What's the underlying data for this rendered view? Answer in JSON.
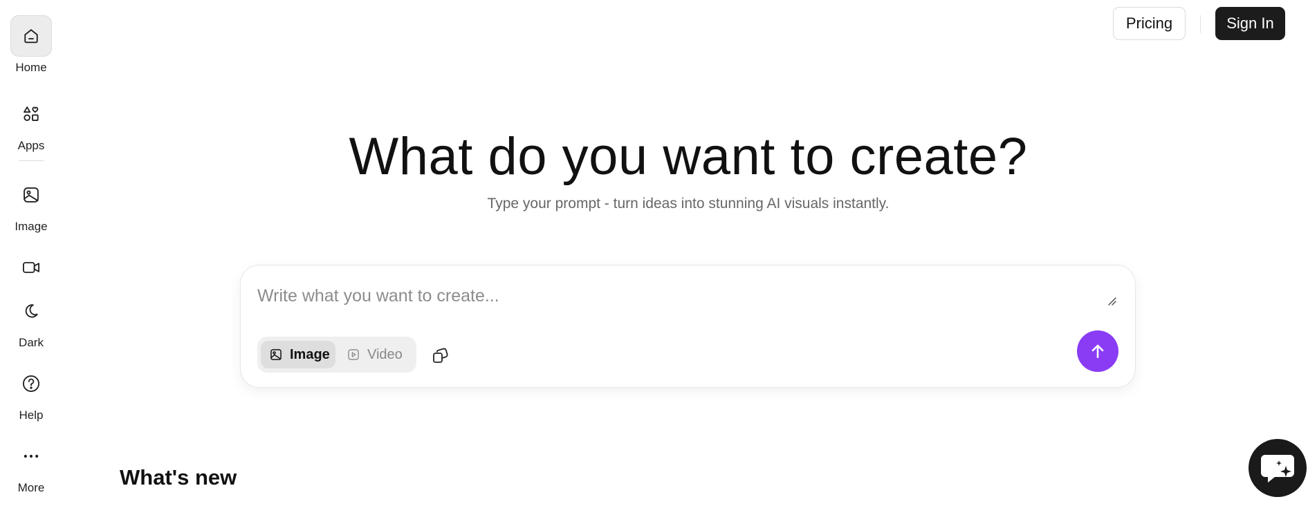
{
  "sidebar": {
    "items": [
      {
        "label": "Home",
        "icon": "home-icon"
      },
      {
        "label": "Apps",
        "icon": "apps-icon"
      },
      {
        "label": "Image",
        "icon": "image-icon"
      },
      {
        "label": "",
        "icon": "video-camera-icon"
      },
      {
        "label": "Dark",
        "icon": "moon-icon"
      },
      {
        "label": "Help",
        "icon": "help-circle-icon"
      },
      {
        "label": "More",
        "icon": "more-dots-icon"
      }
    ]
  },
  "header": {
    "pricing_label": "Pricing",
    "signin_label": "Sign In"
  },
  "hero": {
    "title": "What do you want to create?",
    "subtitle": "Type your prompt - turn ideas into stunning AI visuals instantly."
  },
  "prompt": {
    "placeholder": "Write what you want to create...",
    "value": "",
    "modes": [
      {
        "label": "Image",
        "selected": true,
        "icon": "image-icon"
      },
      {
        "label": "Video",
        "selected": false,
        "icon": "play-square-icon"
      }
    ],
    "style_icon": "styles-icon",
    "submit_icon": "arrow-up-icon"
  },
  "sections": {
    "whats_new_title": "What's new"
  },
  "chat": {
    "icon": "chat-sparkle-icon"
  },
  "colors": {
    "accent": "#8a3cf5",
    "dark_button": "#1c1c1c",
    "muted_text": "#666666"
  }
}
